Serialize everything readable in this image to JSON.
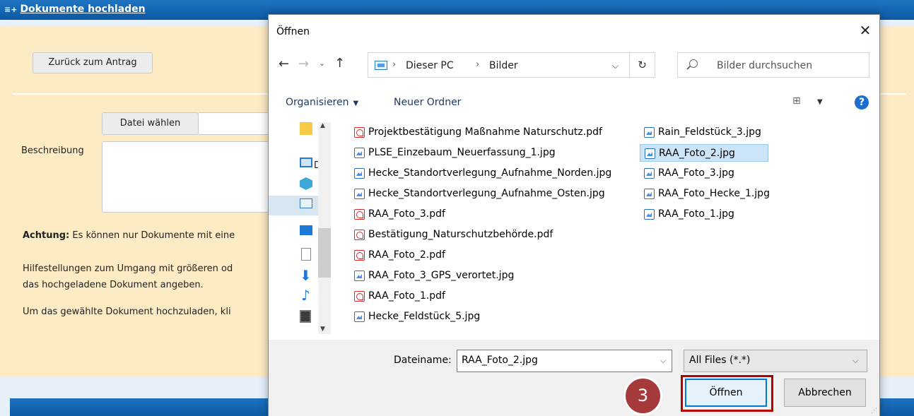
{
  "page": {
    "header_title": "Dokumente hochladen",
    "back_button": "Zurück zum Antrag",
    "file_button": "Datei wählen",
    "description_label": "Beschreibung",
    "notice_bold": "Achtung:",
    "notice_text": " Es können nur Dokumente mit eine",
    "help_line1": "Hilfestellungen zum Umgang mit größeren od",
    "help_line2": "das hochgeladene Dokument angeben.",
    "upload_line": "Um das gewählte Dokument hochzuladen, kli"
  },
  "dialog": {
    "title": "Öffnen",
    "close": "✕",
    "breadcrumb": [
      "Dieser PC",
      "Bilder"
    ],
    "search_placeholder": "Bilder durchsuchen",
    "toolbar": {
      "organize": "Organisieren",
      "new_folder": "Neuer Ordner",
      "help": "?"
    },
    "nav_partial_label": "D",
    "files_col1": [
      {
        "name": "Projektbestätigung Maßnahme Naturschutz.pdf",
        "type": "pdf"
      },
      {
        "name": "PLSE_Einzebaum_Neuerfassung_1.jpg",
        "type": "jpg"
      },
      {
        "name": "Hecke_Standortverlegung_Aufnahme_Norden.jpg",
        "type": "jpg"
      },
      {
        "name": "Hecke_Standortverlegung_Aufnahme_Osten.jpg",
        "type": "jpg"
      },
      {
        "name": "RAA_Foto_3.pdf",
        "type": "pdf"
      },
      {
        "name": "Bestätigung_Naturschutzbehörde.pdf",
        "type": "pdf"
      },
      {
        "name": "RAA_Foto_2.pdf",
        "type": "pdf"
      },
      {
        "name": "RAA_Foto_3_GPS_verortet.jpg",
        "type": "jpg"
      },
      {
        "name": "RAA_Foto_1.pdf",
        "type": "pdf"
      },
      {
        "name": "Hecke_Feldstück_5.jpg",
        "type": "jpg"
      }
    ],
    "files_col2": [
      {
        "name": "Rain_Feldstück_3.jpg",
        "type": "jpg"
      },
      {
        "name": "RAA_Foto_2.jpg",
        "type": "jpg",
        "selected": true
      },
      {
        "name": "RAA_Foto_3.jpg",
        "type": "jpg"
      },
      {
        "name": "RAA_Foto_Hecke_1.jpg",
        "type": "jpg"
      },
      {
        "name": "RAA_Foto_1.jpg",
        "type": "jpg"
      }
    ],
    "filename_label": "Dateiname:",
    "filename_value": "RAA_Foto_2.jpg",
    "filetype_value": "All Files (*.*)",
    "open_button": "Öffnen",
    "cancel_button": "Abbrechen",
    "step_badge": "3"
  },
  "colors": {
    "accent": "#0078d7",
    "highlight": "#b30000",
    "badge": "#a63a3a",
    "page_panel": "#fdebc4",
    "header_blue": "#1068b8"
  }
}
